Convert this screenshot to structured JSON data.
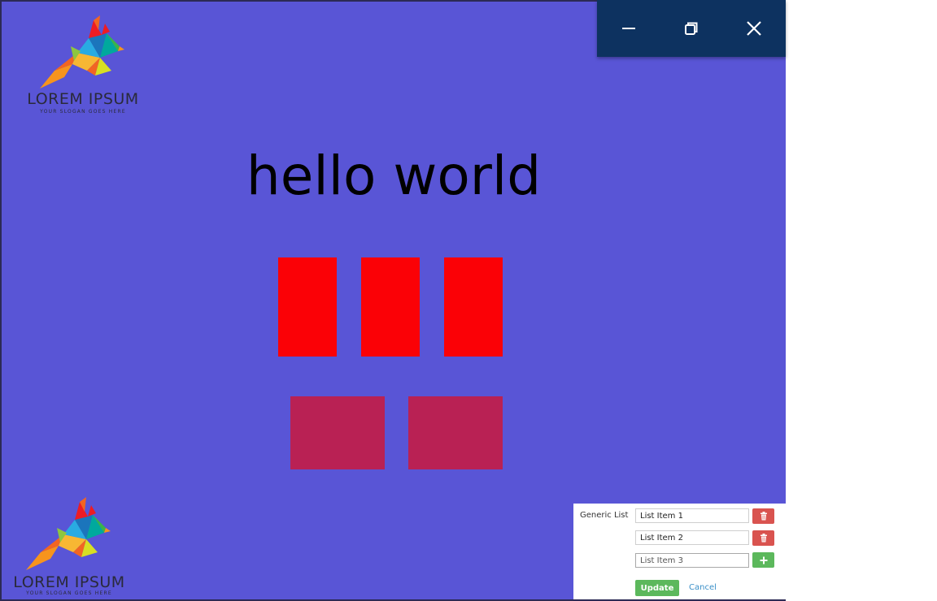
{
  "window_controls": {
    "minimize_icon": "minimize-icon",
    "restore_icon": "restore-icon",
    "close_icon": "close-icon",
    "bar_color": "#0d3260"
  },
  "logo": {
    "name": "LOREM IPSUM",
    "tagline": "YOUR SLOGAN GOES HERE",
    "icon": "bird-logo-icon"
  },
  "main": {
    "headline": "hello world",
    "background_color": "#5955d6",
    "red_tile_color": "#fb0106",
    "maroon_tile_color": "#b92154"
  },
  "generic_list": {
    "label": "Generic List",
    "items": [
      {
        "value": "List Item 1",
        "action_icon": "trash-icon"
      },
      {
        "value": "List Item 2",
        "action_icon": "trash-icon"
      }
    ],
    "new_item_placeholder": "List Item 3",
    "add_icon": "plus-icon",
    "update_label": "Update",
    "cancel_label": "Cancel",
    "delete_color": "#d9534f",
    "add_color": "#5cb85c"
  }
}
